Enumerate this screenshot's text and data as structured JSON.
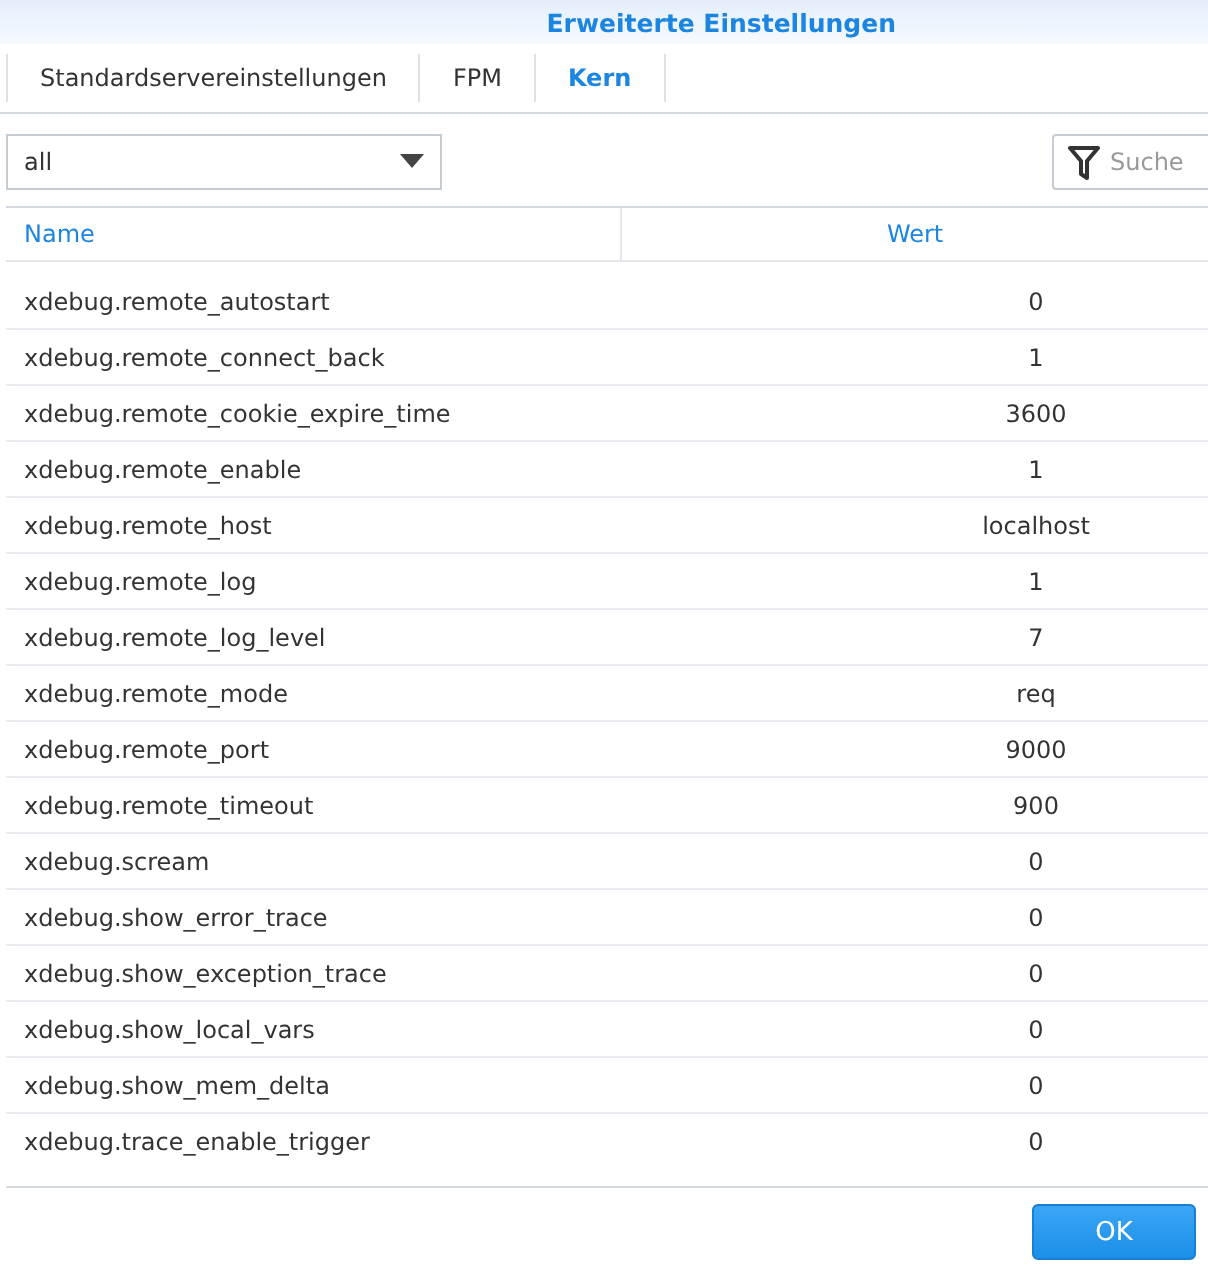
{
  "window": {
    "title": "Erweiterte Einstellungen"
  },
  "tabs": [
    {
      "label": "Standardservereinstellungen",
      "selected": false
    },
    {
      "label": "FPM",
      "selected": false
    },
    {
      "label": "Kern",
      "selected": true
    }
  ],
  "filter": {
    "value": "all"
  },
  "search": {
    "placeholder": "Suche"
  },
  "table": {
    "columns": [
      "Name",
      "Wert"
    ],
    "rows": [
      [
        "xdebug.remote_autostart",
        "0"
      ],
      [
        "xdebug.remote_connect_back",
        "1"
      ],
      [
        "xdebug.remote_cookie_expire_time",
        "3600"
      ],
      [
        "xdebug.remote_enable",
        "1"
      ],
      [
        "xdebug.remote_host",
        "localhost"
      ],
      [
        "xdebug.remote_log",
        "1"
      ],
      [
        "xdebug.remote_log_level",
        "7"
      ],
      [
        "xdebug.remote_mode",
        "req"
      ],
      [
        "xdebug.remote_port",
        "9000"
      ],
      [
        "xdebug.remote_timeout",
        "900"
      ],
      [
        "xdebug.scream",
        "0"
      ],
      [
        "xdebug.show_error_trace",
        "0"
      ],
      [
        "xdebug.show_exception_trace",
        "0"
      ],
      [
        "xdebug.show_local_vars",
        "0"
      ],
      [
        "xdebug.show_mem_delta",
        "0"
      ],
      [
        "xdebug.trace_enable_trigger",
        "0"
      ]
    ]
  },
  "buttons": [
    "OK"
  ]
}
